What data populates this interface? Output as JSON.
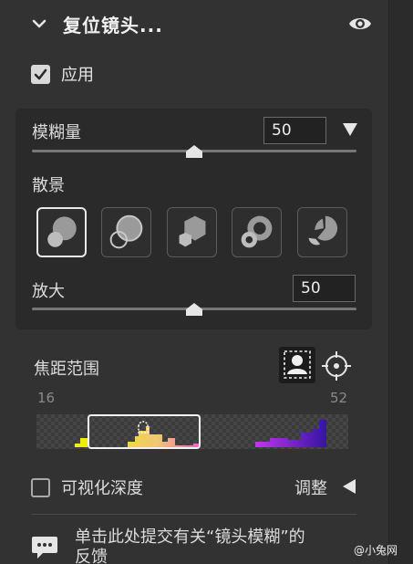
{
  "header": {
    "title": "复位镜头...",
    "visibility_icon": "eye-icon",
    "collapse_icon": "chevron-down-icon"
  },
  "apply": {
    "label": "应用",
    "checked": true
  },
  "blur_amount": {
    "label": "模糊量",
    "value": "50",
    "slider_fraction": 0.5,
    "dropdown_icon": "triangle-down-icon"
  },
  "bokeh": {
    "label": "散景",
    "shapes": [
      {
        "icon": "bokeh-circle-icon",
        "selected": true
      },
      {
        "icon": "bokeh-ring-icon",
        "selected": false
      },
      {
        "icon": "bokeh-hexagon-icon",
        "selected": false
      },
      {
        "icon": "bokeh-donut-icon",
        "selected": false
      },
      {
        "icon": "bokeh-segmented-icon",
        "selected": false
      }
    ]
  },
  "magnify": {
    "label": "放大",
    "value": "50",
    "slider_fraction": 0.5
  },
  "focus_range": {
    "label": "焦距范围",
    "min_tick": "16",
    "max_tick": "52",
    "subject_icon": "person-focus-icon",
    "target_icon": "crosshair-target-icon"
  },
  "visualize_depth": {
    "label": "可视化深度",
    "checked": false
  },
  "adjust": {
    "label": "调整",
    "icon": "triangle-left-icon"
  },
  "feedback": {
    "text": "单击此处提交有关“镜头模糊”的反馈",
    "icon": "chat-bubble-icon"
  },
  "watermark": {
    "text": "@小兔网"
  },
  "colors": {
    "panel_bg": "#323232",
    "subpanel_bg": "#2a2a2a",
    "text": "#dcdcdc",
    "accent_white": "#e8e8e8"
  }
}
